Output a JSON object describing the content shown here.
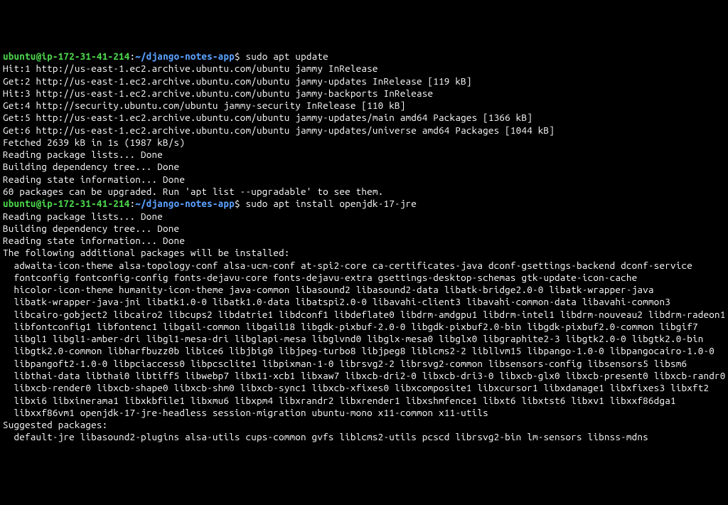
{
  "prompt1": {
    "user": "ubuntu",
    "at": "@",
    "host": "ip-172-31-41-214",
    "colon": ":",
    "path": "~/django-notes-app",
    "dollar": "$",
    "command": "sudo apt update"
  },
  "apt_update_output": [
    "Hit:1 http://us-east-1.ec2.archive.ubuntu.com/ubuntu jammy InRelease",
    "Get:2 http://us-east-1.ec2.archive.ubuntu.com/ubuntu jammy-updates InRelease [119 kB]",
    "Hit:3 http://us-east-1.ec2.archive.ubuntu.com/ubuntu jammy-backports InRelease",
    "Get:4 http://security.ubuntu.com/ubuntu jammy-security InRelease [110 kB]",
    "Get:5 http://us-east-1.ec2.archive.ubuntu.com/ubuntu jammy-updates/main amd64 Packages [1366 kB]",
    "Get:6 http://us-east-1.ec2.archive.ubuntu.com/ubuntu jammy-updates/universe amd64 Packages [1044 kB]",
    "Fetched 2639 kB in 1s (1987 kB/s)",
    "Reading package lists... Done",
    "Building dependency tree... Done",
    "Reading state information... Done",
    "60 packages can be upgraded. Run 'apt list --upgradable' to see them."
  ],
  "prompt2": {
    "user": "ubuntu",
    "at": "@",
    "host": "ip-172-31-41-214",
    "colon": ":",
    "path": "~/django-notes-app",
    "dollar": "$",
    "command": "sudo apt install openjdk-17-jre"
  },
  "apt_install_output_top": [
    "Reading package lists... Done",
    "Building dependency tree... Done",
    "Reading state information... Done",
    "The following additional packages will be installed:"
  ],
  "additional_packages_lines": [
    "  adwaita-icon-theme alsa-topology-conf alsa-ucm-conf at-spi2-core ca-certificates-java dconf-gsettings-backend dconf-service",
    "  fontconfig fontconfig-config fonts-dejavu-core fonts-dejavu-extra gsettings-desktop-schemas gtk-update-icon-cache",
    "  hicolor-icon-theme humanity-icon-theme java-common libasound2 libasound2-data libatk-bridge2.0-0 libatk-wrapper-java",
    "  libatk-wrapper-java-jni libatk1.0-0 libatk1.0-data libatspi2.0-0 libavahi-client3 libavahi-common-data libavahi-common3",
    "  libcairo-gobject2 libcairo2 libcups2 libdatrie1 libdconf1 libdeflate0 libdrm-amdgpu1 libdrm-intel1 libdrm-nouveau2 libdrm-radeon1",
    "  libfontconfig1 libfontenc1 libgail-common libgail18 libgdk-pixbuf-2.0-0 libgdk-pixbuf2.0-bin libgdk-pixbuf2.0-common libgif7",
    "  libgl1 libgl1-amber-dri libgl1-mesa-dri libglapi-mesa libglvnd0 libglx-mesa0 libglx0 libgraphite2-3 libgtk2.0-0 libgtk2.0-bin",
    "  libgtk2.0-common libharfbuzz0b libice6 libjbig0 libjpeg-turbo8 libjpeg8 liblcms2-2 libllvm15 libpango-1.0-0 libpangocairo-1.0-0",
    "  libpangoft2-1.0-0 libpciaccess0 libpcsclite1 libpixman-1-0 librsvg2-2 librsvg2-common libsensors-config libsensors5 libsm6",
    "  libthai-data libthai0 libtiff5 libwebp7 libx11-xcb1 libxaw7 libxcb-dri2-0 libxcb-dri3-0 libxcb-glx0 libxcb-present0 libxcb-randr0",
    "  libxcb-render0 libxcb-shape0 libxcb-shm0 libxcb-sync1 libxcb-xfixes0 libxcomposite1 libxcursor1 libxdamage1 libxfixes3 libxft2",
    "  libxi6 libxinerama1 libxkbfile1 libxmu6 libxpm4 libxrandr2 libxrender1 libxshmfence1 libxt6 libxtst6 libxv1 libxxf86dga1",
    "  libxxf86vm1 openjdk-17-jre-headless session-migration ubuntu-mono x11-common x11-utils"
  ],
  "suggested_header": "Suggested packages:",
  "suggested_packages_lines": [
    "  default-jre libasound2-plugins alsa-utils cups-common gvfs liblcms2-utils pcscd librsvg2-bin lm-sensors libnss-mdns"
  ]
}
